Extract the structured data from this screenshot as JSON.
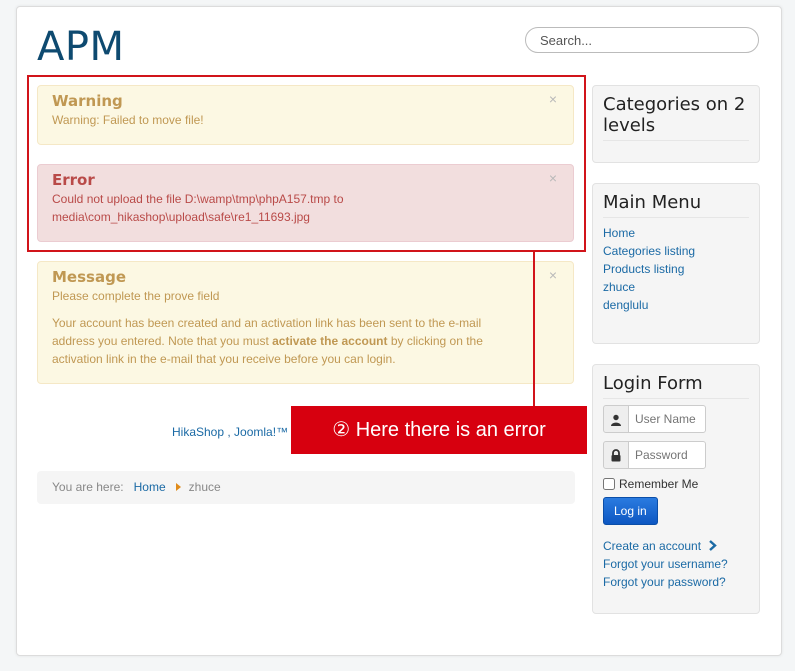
{
  "site": {
    "brand": "APM"
  },
  "search": {
    "placeholder": "Search..."
  },
  "alerts": {
    "warning": {
      "title": "Warning",
      "text": "Warning: Failed to move file!",
      "close": "×"
    },
    "error": {
      "title": "Error",
      "line1": "Could not upload the file D:\\wamp\\tmp\\phpA157.tmp to",
      "line2": "media\\com_hikashop\\upload\\safe\\re1_11693.jpg",
      "close": "×"
    },
    "message": {
      "title": "Message",
      "line1": "Please complete the prove field",
      "p2_line1": "Your account has been created and an activation link has been sent to the e-mail",
      "p2_line2_pre": "address you entered. Note that you must ",
      "p2_line2_bold": "activate the account",
      "p2_line2_post": " by clicking on the",
      "p2_line3": "activation link in the e-mail that you receive before you can login.",
      "close": "×"
    }
  },
  "annotation": {
    "text": "②  Here there is an error"
  },
  "footer": {
    "link1": "HikaShop",
    "sep": " , ",
    "link2": "Joomla!™"
  },
  "breadcrumb": {
    "prefix": "You are here:",
    "home": "Home",
    "current": "zhuce"
  },
  "sidebar": {
    "categories_title": "Categories on 2 levels",
    "main_menu": {
      "title": "Main Menu",
      "items": [
        "Home",
        "Categories listing",
        "Products listing",
        "zhuce",
        "denglulu"
      ]
    },
    "login": {
      "title": "Login Form",
      "username_placeholder": "User Name",
      "password_placeholder": "Password",
      "remember": "Remember Me",
      "button": "Log in",
      "create": "Create an account",
      "forgot_user": "Forgot your username?",
      "forgot_pass": "Forgot your password?"
    }
  }
}
